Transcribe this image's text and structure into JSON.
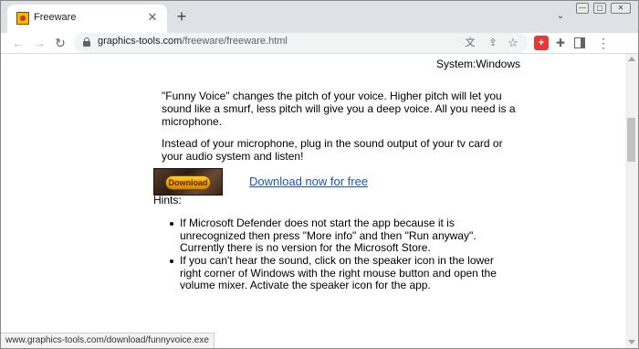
{
  "browser": {
    "tab": {
      "title": "Freeware",
      "close_glyph": "✕"
    },
    "new_tab_glyph": "+",
    "window_controls": {
      "minimize": "—",
      "restore": "▢",
      "close": "✕"
    },
    "nav": {
      "back": "←",
      "forward": "→",
      "reload": "↻"
    },
    "address": {
      "host": "graphics-tools.com",
      "path": "/freeware/freeware.html"
    },
    "toolbar_icons": {
      "translate": "文",
      "share": "⇪",
      "bookmark": "☆",
      "extension_red": "+",
      "puzzle": "✚",
      "menu": "⋮"
    }
  },
  "page": {
    "system": "System:Windows",
    "paragraph1": "\"Funny Voice\" changes the pitch of your voice. Higher pitch will let you sound like a smurf, less pitch will give you a deep voice. All you need is a microphone.",
    "paragraph2": "Instead of your microphone, plug in the sound output of your tv card or your audio system and listen!",
    "download_button_label": "Download",
    "download_link": "Download now for free",
    "hints_label": "Hints:",
    "hints": [
      "If Microsoft Defender does not start the app because it is unrecognized then press \"More info\" and then \"Run anyway\". Currently there is no version for the Microsoft Store.",
      "If you can't hear the sound, click on the speaker icon in the lower right corner of Windows with the right mouse button and open the volume mixer. Activate the speaker icon for the app."
    ]
  },
  "status_url": "www.graphics-tools.com/download/funnyvoice.exe"
}
